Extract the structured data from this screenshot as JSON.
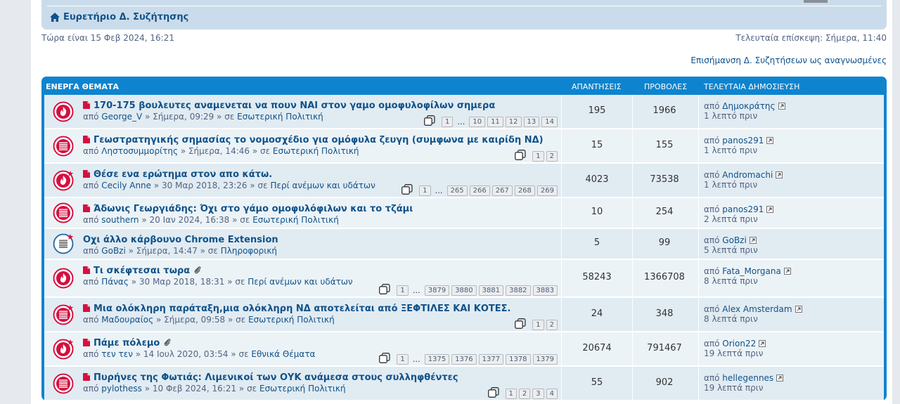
{
  "breadcrumb": {
    "label": "Ευρετήριο Δ. Συζήτησης"
  },
  "status": {
    "current_time": "Τώρα είναι 15 Φεβ 2024, 16:21",
    "last_visit": "Τελευταία επίσκεψη: Σήμερα, 11:40",
    "mark_read": "Επισήμανση Δ. Συζητήσεων ως αναγνωσμένες"
  },
  "table": {
    "headers": {
      "topics": "ΕΝΕΡΓΑ ΘΕΜΑΤΑ",
      "replies": "ΑΠΑΝΤΗΣΕΙΣ",
      "views": "ΠΡΟΒΟΛΕΣ",
      "last_post": "ΤΕΛΕΥΤΑΙΑ ΔΗΜΟΣΙΕΥΣΗ"
    },
    "rows": [
      {
        "icon": "hot-topic-icon",
        "unread": true,
        "title": "170-175 βουλευτες αναμενεται να πουν ΝΑΙ στον γαμο ομοφυλοφίλων σημερα",
        "by_prefix": "από",
        "author": "George_V",
        "date": "» Σήμερα, 09:29 » σε",
        "forum": "Εσωτερική Πολιτική",
        "pages_first": "1",
        "ellipsis": "…",
        "pages_tail": [
          "10",
          "11",
          "12",
          "13",
          "14"
        ],
        "replies": "195",
        "views": "1966",
        "last_by_prefix": "από",
        "last_author": "Δημοκράτης",
        "last_time": "1 λεπτό πριν"
      },
      {
        "icon": "topic-list-icon",
        "unread": true,
        "title": "Γεωστρατηγικής σημασίας το νομοσχέδιο για ομόφυλα ζευγη (συμφωνα με καιρίδη ΝΔ)",
        "by_prefix": "από",
        "author": "Ληστοσυμμορίτης",
        "date": "» Σήμερα, 14:46 » σε",
        "forum": "Εσωτερική Πολιτική",
        "pages_first": "1",
        "ellipsis": "",
        "pages_tail": [
          "2"
        ],
        "replies": "15",
        "views": "155",
        "last_by_prefix": "από",
        "last_author": "panos291",
        "last_time": "1 λεπτό πριν"
      },
      {
        "icon": "hot-topic-mine-icon",
        "unread": true,
        "title": "Θέσε ενα ερώτημα στον απο κάτω.",
        "by_prefix": "από",
        "author": "Cecily Anne",
        "date": "» 30 Μαρ 2018, 23:26 » σε",
        "forum": "Περί ανέμων και υδάτων",
        "pages_first": "1",
        "ellipsis": "…",
        "pages_tail": [
          "265",
          "266",
          "267",
          "268",
          "269"
        ],
        "replies": "4023",
        "views": "73538",
        "last_by_prefix": "από",
        "last_author": "Andromachi",
        "last_time": "1 λεπτό πριν"
      },
      {
        "icon": "topic-list-icon",
        "unread": true,
        "title": "Άδωνις Γεωργιάδης: Όχι στο γάμο ομοφυλόφιλων και το τζάμι",
        "by_prefix": "από",
        "author": "southern",
        "date": "» 20 Ιαν 2024, 16:38 » σε",
        "forum": "Εσωτερική Πολιτική",
        "pages_first": "",
        "ellipsis": "",
        "pages_tail": [],
        "replies": "10",
        "views": "254",
        "last_by_prefix": "από",
        "last_author": "panos291",
        "last_time": "2 λεπτά πριν"
      },
      {
        "icon": "topic-read-mine-icon",
        "unread": false,
        "title": "Οχι άλλο κάρβουνο Chrome Extension",
        "by_prefix": "από",
        "author": "GoBzi",
        "date": "» Σήμερα, 14:47 » σε",
        "forum": "Πληροφορική",
        "pages_first": "",
        "ellipsis": "",
        "pages_tail": [],
        "replies": "5",
        "views": "99",
        "last_by_prefix": "από",
        "last_author": "GoBzi",
        "last_time": "5 λεπτά πριν"
      },
      {
        "icon": "hot-topic-icon",
        "unread": true,
        "attachment": true,
        "title": "Τι σκέφτεσαι τωρα",
        "by_prefix": "από",
        "author": "Πάνας",
        "date": "» 30 Μαρ 2018, 18:31 » σε",
        "forum": "Περί ανέμων και υδάτων",
        "pages_first": "1",
        "ellipsis": "…",
        "pages_tail": [
          "3879",
          "3880",
          "3881",
          "3882",
          "3883"
        ],
        "replies": "58243",
        "views": "1366708",
        "last_by_prefix": "από",
        "last_author": "Fata_Morgana",
        "last_time": "8 λεπτά πριν"
      },
      {
        "icon": "topic-list-mine-icon",
        "unread": true,
        "title": "Μια ολόκληρη παράταξη,μια ολόκληρη ΝΔ αποτελείται από ΞΕΦΤΙΛΕΣ ΚΑΙ ΚΟΤΕΣ.",
        "by_prefix": "από",
        "author": "Μαδουραίος",
        "date": "» Σήμερα, 09:58 » σε",
        "forum": "Εσωτερική Πολιτική",
        "pages_first": "1",
        "ellipsis": "",
        "pages_tail": [
          "2"
        ],
        "replies": "24",
        "views": "348",
        "last_by_prefix": "από",
        "last_author": "Alex Amsterdam",
        "last_time": "8 λεπτά πριν"
      },
      {
        "icon": "hot-topic-mine-icon",
        "unread": true,
        "attachment": true,
        "title": "Πάμε πόλεμο",
        "by_prefix": "από",
        "author": "τεν τεν",
        "date": "» 14 Ιουλ 2020, 03:54 » σε",
        "forum": "Εθνικά Θέματα",
        "pages_first": "1",
        "ellipsis": "…",
        "pages_tail": [
          "1375",
          "1376",
          "1377",
          "1378",
          "1379"
        ],
        "replies": "20674",
        "views": "791467",
        "last_by_prefix": "από",
        "last_author": "Orion22",
        "last_time": "19 λεπτά πριν"
      },
      {
        "icon": "topic-list-icon",
        "unread": true,
        "title": "Πυρήνες της Φωτιάς: Λιμενικοί των ΟΥΚ ανάμεσα στους συλληφθέντες",
        "by_prefix": "από",
        "author": "pylothess",
        "date": "» 10 Φεβ 2024, 16:21 » σε",
        "forum": "Εσωτερική Πολιτική",
        "pages_first": "1",
        "ellipsis": "",
        "pages_tail": [
          "2",
          "3",
          "4"
        ],
        "replies": "55",
        "views": "902",
        "last_by_prefix": "από",
        "last_author": "hellegennes",
        "last_time": "19 λεπτά πριν"
      }
    ]
  },
  "colors": {
    "accent": "#0e84cf",
    "unread": "#d31141",
    "link": "#105289",
    "read": "#2e6ea5"
  }
}
